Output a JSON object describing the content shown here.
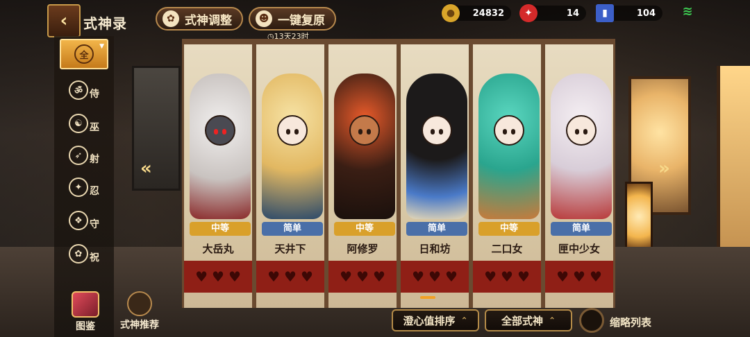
{
  "header": {
    "back_icon": "back-arrow-icon",
    "title": "式神录",
    "adjust_button": "式神调整",
    "reset_button": "一键复原",
    "reset_timer": "13天23时"
  },
  "resources": {
    "gold": "24832",
    "red_ticket": "14",
    "blue_ticket": "104",
    "wifi_icon": "wifi-icon"
  },
  "sidebar": {
    "items": [
      {
        "glyph": "全",
        "label": "全",
        "icon": "all-icon"
      },
      {
        "glyph": "ॐ",
        "label": "侍",
        "icon": "attendant-icon"
      },
      {
        "glyph": "☯",
        "label": "巫",
        "icon": "shaman-icon"
      },
      {
        "glyph": "➶",
        "label": "射",
        "icon": "archer-icon"
      },
      {
        "glyph": "✦",
        "label": "忍",
        "icon": "ninja-icon"
      },
      {
        "glyph": "❖",
        "label": "守",
        "icon": "guardian-icon"
      },
      {
        "glyph": "✿",
        "label": "祝",
        "icon": "blessing-icon"
      }
    ],
    "illustrated_label": "图鉴",
    "recommend_label": "式神推荐"
  },
  "characters": [
    {
      "name": "大岳丸",
      "difficulty": "中等",
      "diff_color": "#d9a02a",
      "palette": "#d7d4d2"
    },
    {
      "name": "天井下",
      "difficulty": "简单",
      "diff_color": "#4a6fa8",
      "palette": "#f0d48a"
    },
    {
      "name": "阿修罗",
      "difficulty": "中等",
      "diff_color": "#d9a02a",
      "palette": "#2a1a14"
    },
    {
      "name": "日和坊",
      "difficulty": "简单",
      "diff_color": "#4a6fa8",
      "palette": "#1a1a1a"
    },
    {
      "name": "二口女",
      "difficulty": "中等",
      "diff_color": "#d9a02a",
      "palette": "#3cb8a0"
    },
    {
      "name": "匣中少女",
      "difficulty": "简单",
      "diff_color": "#4a6fa8",
      "palette": "#e9e4ea"
    }
  ],
  "footer": {
    "sort_button": "澄心值排序",
    "filter_button": "全部式神",
    "compact_label": "缩略列表"
  },
  "colors": {
    "accent": "#f3a024",
    "gold_trim": "#b88a4e",
    "heart_band": "#8f1f16"
  }
}
